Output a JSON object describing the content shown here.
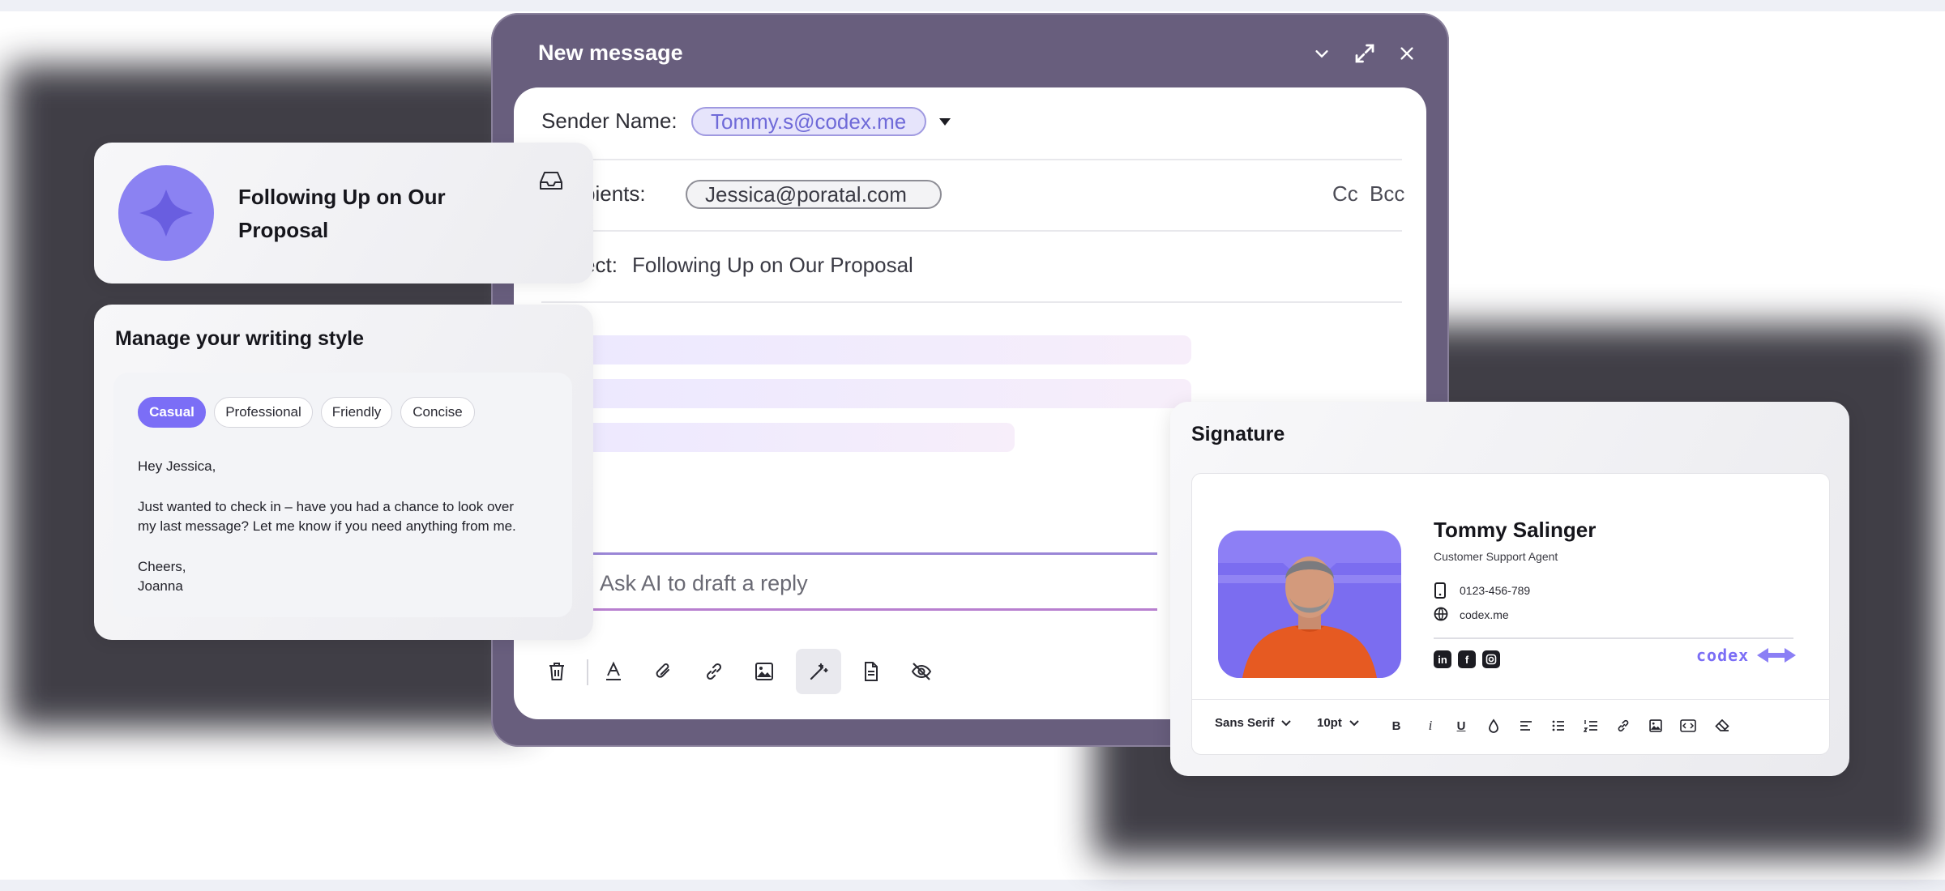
{
  "compose": {
    "title": "New message",
    "sender_label": "Sender Name:",
    "sender_value": "Tommy.s@codex.me",
    "recipients_label": "Recipients:",
    "recipient_value": "Jessica@poratal.com",
    "cc": "Cc",
    "bcc": "Bcc",
    "subject_label": "Subject:",
    "subject_value": "Following Up on Our Proposal",
    "ai_placeholder": "Ask AI to draft a reply",
    "toolbar_icons": [
      "trash-icon",
      "text-color-icon",
      "attach-icon",
      "link-icon",
      "image-icon",
      "magic-wand-icon",
      "document-icon",
      "eye-off-icon"
    ]
  },
  "proposal_card": {
    "title_line1": "Following Up on Our",
    "title_line2": "Proposal"
  },
  "style_card": {
    "title": "Manage your writing style",
    "chips": [
      "Casual",
      "Professional",
      "Friendly",
      "Concise"
    ],
    "active_chip": "Casual",
    "message": {
      "greeting": "Hey Jessica,",
      "body_line1": "Just wanted to check in – have you had a chance to look over",
      "body_line2": "my last message? Let me know if you need anything from me.",
      "closing": "Cheers,",
      "sender": "Joanna"
    }
  },
  "signature": {
    "title": "Signature",
    "name": "Tommy Salinger",
    "role": "Customer Support Agent",
    "phone": "0123-456-789",
    "website": "codex.me",
    "brand": "codex",
    "font": "Sans Serif",
    "size": "10pt",
    "format_tools": [
      "B",
      "i",
      "U"
    ]
  },
  "colors": {
    "frame": "#685e7d",
    "accent": "#7b6ef6",
    "sender_pill": "#e6e4fb"
  }
}
